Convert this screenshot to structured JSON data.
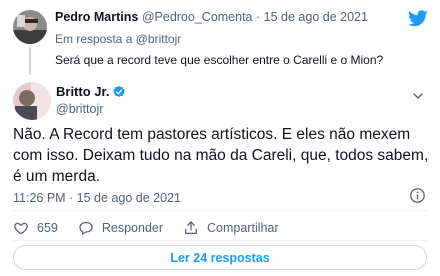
{
  "reply_tweet": {
    "author_name": "Pedro Martins",
    "author_handle": "@Pedroo_Comenta",
    "separator": "·",
    "date": "15 de ago de 2021",
    "in_reply_prefix": "Em resposta a",
    "in_reply_handle": "@brittojr",
    "text": "Será que a record teve que escolher entre o Carelli e o Mion?"
  },
  "main_tweet": {
    "author_name": "Britto Jr.",
    "author_handle": "@brittojr",
    "text": "Não. A Record tem pastores artísticos. E eles não mexem com  isso. Deixam tudo na mão da Careli, que, todos sabem, é um merda.",
    "timestamp": "11:26 PM · 15 de ago de 2021"
  },
  "actions": {
    "like_count": "659",
    "reply_label": "Responder",
    "share_label": "Compartilhar"
  },
  "replies_button_label": "Ler 24 respostas",
  "colors": {
    "accent": "#1d9bf0",
    "like": "#536471",
    "text": "#0f1419",
    "muted": "#536471"
  },
  "icons": [
    "twitter-bird-icon",
    "verified-badge-icon",
    "chevron-down-icon",
    "info-icon",
    "heart-icon",
    "reply-bubble-icon",
    "share-upload-icon"
  ]
}
